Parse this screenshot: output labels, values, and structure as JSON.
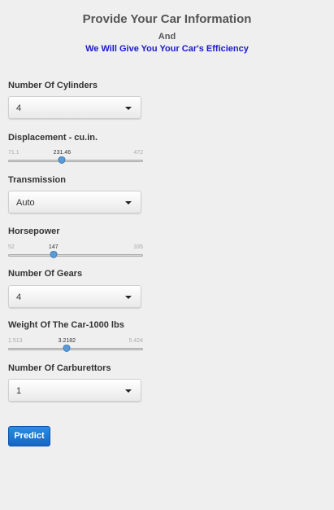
{
  "header": {
    "title": "Provide Your Car Information",
    "line1": "And",
    "line2": "We Will Give You Your Car's Efficiency"
  },
  "cylinders": {
    "label": "Number Of Cylinders",
    "value": "4"
  },
  "displacement": {
    "label": "Displacement - cu.in.",
    "min": "71.1",
    "max": "472",
    "value": "231.46",
    "fraction": 0.4
  },
  "transmission": {
    "label": "Transmission",
    "value": "Auto"
  },
  "horsepower": {
    "label": "Horsepower",
    "min": "52",
    "max": "335",
    "value": "147",
    "fraction": 0.336
  },
  "gears": {
    "label": "Number Of Gears",
    "value": "4"
  },
  "weight": {
    "label": "Weight Of The Car-1000 lbs",
    "min": "1.513",
    "max": "5.424",
    "value": "3.2182",
    "fraction": 0.436
  },
  "carburettors": {
    "label": "Number Of Carburettors",
    "value": "1"
  },
  "predict_label": "Predict",
  "colors": {
    "accent": "#1a1acd",
    "button": "#1665c4",
    "background": "#efefef"
  }
}
